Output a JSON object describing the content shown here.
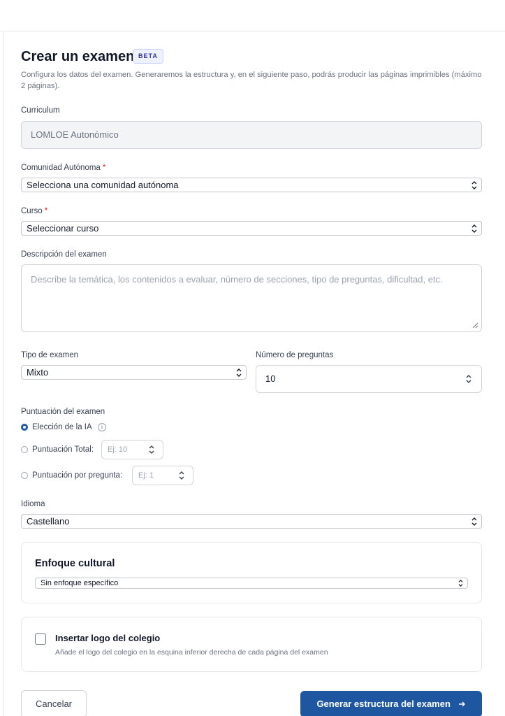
{
  "header": {
    "title": "Crear un examen",
    "badge": "BETA",
    "subtitle": "Configura los datos del examen. Generaremos la estructura y, en el siguiente paso, podrás producir las páginas imprimibles (máximo 2 páginas)."
  },
  "curriculum": {
    "label": "Curriculum",
    "value": "LOMLOE Autonómico"
  },
  "comunidad": {
    "label": "Comunidad Autónoma",
    "required_mark": "*",
    "selected": "Selecciona una comunidad autónoma"
  },
  "curso": {
    "label": "Curso",
    "required_mark": "*",
    "selected": "Seleccionar curso"
  },
  "descripcion": {
    "label": "Descripción del examen",
    "placeholder": "Describe la temática, los contenidos a evaluar, número de secciones, tipo de preguntas, dificultad, etc."
  },
  "tipo": {
    "label": "Tipo de examen",
    "selected": "Mixto"
  },
  "numero_preguntas": {
    "label": "Número de preguntas",
    "value": "10"
  },
  "puntuacion": {
    "label": "Puntuación del examen",
    "options": [
      {
        "label": "Elección de la IA",
        "selected": true,
        "info_icon": "info-icon"
      },
      {
        "label": "Puntuación Total:",
        "selected": false,
        "placeholder": "Ej: 10"
      },
      {
        "label": "Puntuación por pregunta:",
        "selected": false,
        "placeholder": "Ej: 1"
      }
    ]
  },
  "idioma": {
    "label": "Idioma",
    "selected": "Castellano"
  },
  "enfoque": {
    "title": "Enfoque cultural",
    "selected": "Sin enfoque específico"
  },
  "logo": {
    "title": "Insertar logo del colegio",
    "description": "Añade el logo del colegio en la esquina inferior derecha de cada página del examen",
    "checked": false
  },
  "actions": {
    "cancel_label": "Cancelar",
    "submit_label": "Generar estructura del examen",
    "submit_icon": "arrow-right-icon"
  },
  "colors": {
    "primary": "#1e56a0",
    "required": "#dc2626",
    "badge_bg": "#eef2ff",
    "badge_text": "#3730a3"
  }
}
